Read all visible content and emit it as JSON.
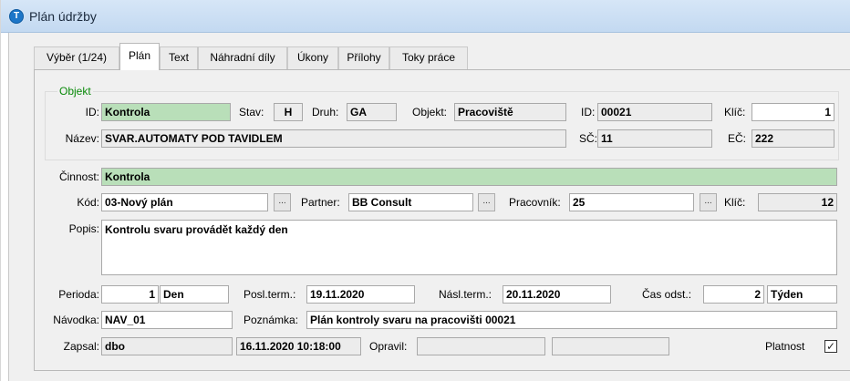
{
  "window": {
    "title": "Plán údržby",
    "icon": "T"
  },
  "tabs": [
    {
      "label": "Výběr (1/24)"
    },
    {
      "label": "Plán"
    },
    {
      "label": "Text"
    },
    {
      "label": "Náhradní díly"
    },
    {
      "label": "Úkony"
    },
    {
      "label": "Přílohy"
    },
    {
      "label": "Toky práce"
    }
  ],
  "objekt": {
    "legend": "Objekt",
    "id_label": "ID:",
    "id_value": "Kontrola",
    "stav_label": "Stav:",
    "stav_value": "H",
    "druh_label": "Druh:",
    "druh_value": "GA",
    "objekt_label": "Objekt:",
    "objekt_value": "Pracoviště",
    "id2_label": "ID:",
    "id2_value": "00021",
    "klic_label": "Klíč:",
    "klic_value": "1",
    "nazev_label": "Název:",
    "nazev_value": "SVAR.AUTOMATY POD TAVIDLEM",
    "sc_label": "SČ:",
    "sc_value": "11",
    "ec_label": "EČ:",
    "ec_value": "222"
  },
  "form": {
    "cinnost_label": "Činnost:",
    "cinnost_value": "Kontrola",
    "kod_label": "Kód:",
    "kod_value": "03-Nový plán",
    "partner_label": "Partner:",
    "partner_value": "BB Consult",
    "pracovnik_label": "Pracovník:",
    "pracovnik_value": "25",
    "klic_label": "Klíč:",
    "klic_value": "12",
    "popis_label": "Popis:",
    "popis_value": "Kontrolu svaru provádět každý den",
    "perioda_label": "Perioda:",
    "perioda_value": "1",
    "perioda_unit": "Den",
    "posl_label": "Posl.term.:",
    "posl_value": "19.11.2020",
    "nasl_label": "Násl.term.:",
    "nasl_value": "20.11.2020",
    "cas_label": "Čas odst.:",
    "cas_value": "2",
    "cas_unit": "Týden",
    "navodka_label": "Návodka:",
    "navodka_value": "NAV_01",
    "poznamka_label": "Poznámka:",
    "poznamka_value": "Plán kontroly svaru na pracovišti 00021",
    "zapsal_label": "Zapsal:",
    "zapsal_value": "dbo",
    "zapsal_date": "16.11.2020 10:18:00",
    "opravil_label": "Opravil:",
    "opravil_value": "",
    "opravil_date": "",
    "platnost_label": "Platnost",
    "platnost_checked": "✓",
    "ellipsis": "..."
  }
}
